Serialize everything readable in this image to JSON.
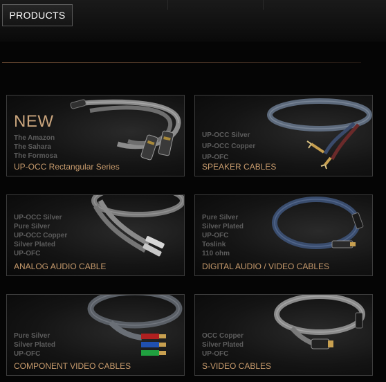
{
  "nav": {
    "products_label": "PRODUCTS"
  },
  "cards": [
    {
      "badge": "NEW",
      "lines": [
        "The Amazon",
        "The Sahara",
        "The Formosa"
      ],
      "title": "UP-OCC Rectangular Series"
    },
    {
      "lines": [
        "UP-OCC Silver",
        "UP-OCC Copper",
        "UP-OFC"
      ],
      "title": "SPEAKER CABLES"
    },
    {
      "lines": [
        "UP-OCC Silver",
        "Pure Silver",
        "UP-OCC Copper",
        "Silver Plated",
        "UP-OFC"
      ],
      "title": "ANALOG AUDIO CABLE"
    },
    {
      "lines": [
        "Pure Silver",
        "Silver Plated",
        "UP-OFC",
        "Toslink",
        "110 ohm"
      ],
      "title": "DIGITAL AUDIO / VIDEO CABLES"
    },
    {
      "lines": [
        "Pure Silver",
        "Silver Plated",
        "UP-OFC"
      ],
      "title": "COMPONENT VIDEO CABLES"
    },
    {
      "lines": [
        "OCC Copper",
        "Silver Plated",
        "UP-OFC"
      ],
      "title": "S-VIDEO CABLES"
    }
  ]
}
